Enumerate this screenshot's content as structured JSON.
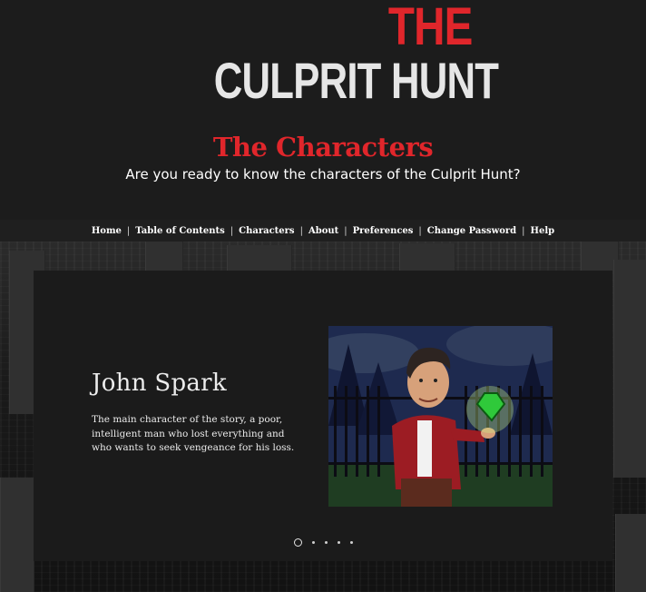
{
  "logo": {
    "line1": "THE",
    "line2": "CULPRIT HUNT"
  },
  "page": {
    "title": "The Characters",
    "subtitle": "Are you ready to know the characters of the Culprit Hunt?"
  },
  "nav": {
    "items": [
      "Home",
      "Table of Contents",
      "Characters",
      "About",
      "Preferences",
      "Change Password",
      "Help"
    ],
    "separator": "|"
  },
  "slider": {
    "slide_count": 5,
    "active_index": 0,
    "current": {
      "name": "John Spark",
      "description": "The main character of the story, a poor, intelligent man who lost everything and who wants to seek vengeance for his loss.",
      "image_icon": "character-portrait"
    }
  },
  "colors": {
    "brand_red": "#e0262b",
    "background": "#1c1c1c",
    "panel": "#1b1b1b",
    "text": "#ffffff"
  }
}
